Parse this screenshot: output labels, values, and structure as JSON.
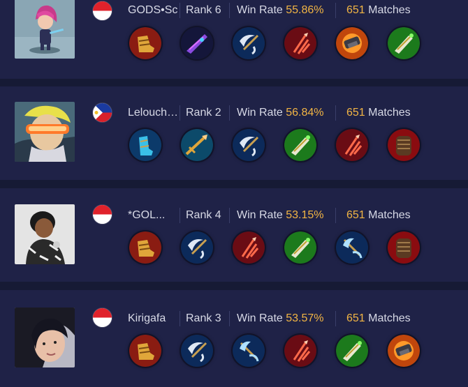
{
  "players": [
    {
      "name": "GODS•Sc",
      "rank_label": "Rank 6",
      "winrate_label": "Win Rate",
      "winrate": "55.86%",
      "matches": "651",
      "matches_label": "Matches",
      "flag": "indonesia-flag",
      "avatar": "purple-hair-hero-avatar",
      "items": [
        "boots-item-icon",
        "purple-blade-item-icon",
        "crescent-axe-item-icon",
        "crimson-trident-item-icon",
        "fire-gauntlet-item-icon",
        "green-blade-item-icon"
      ]
    },
    {
      "name": "Lelouch.M",
      "rank_label": "Rank 2",
      "winrate_label": "Win Rate",
      "winrate": "56.84%",
      "matches": "651",
      "matches_label": "Matches",
      "flag": "philippines-flag",
      "avatar": "visor-hero-avatar",
      "items": [
        "cyan-boots-item-icon",
        "golden-spear-item-icon",
        "crescent-axe-item-icon",
        "green-blade-item-icon",
        "crimson-trident-item-icon",
        "armor-item-icon"
      ]
    },
    {
      "name": "*GOL...",
      "rank_label": "Rank 4",
      "winrate_label": "Win Rate",
      "winrate": "53.15%",
      "matches": "651",
      "matches_label": "Matches",
      "flag": "indonesia-flag",
      "avatar": "player-photo-avatar",
      "items": [
        "boots-item-icon",
        "crescent-axe-item-icon",
        "crimson-trident-item-icon",
        "green-blade-item-icon",
        "frost-axe-item-icon",
        "armor-item-icon"
      ]
    },
    {
      "name": "Kirigafa",
      "rank_label": "Rank 3",
      "winrate_label": "Win Rate",
      "winrate": "53.57%",
      "matches": "651",
      "matches_label": "Matches",
      "flag": "indonesia-flag",
      "avatar": "player-photo-avatar",
      "items": [
        "boots-item-icon",
        "crescent-axe-item-icon",
        "frost-axe-item-icon",
        "crimson-trident-item-icon",
        "green-blade-item-icon",
        "fire-gauntlet-item-icon"
      ]
    }
  ],
  "colors": {
    "background": "#161a35",
    "card": "#1f2247",
    "accent": "#f2b544",
    "text": "#d7d9e6"
  }
}
